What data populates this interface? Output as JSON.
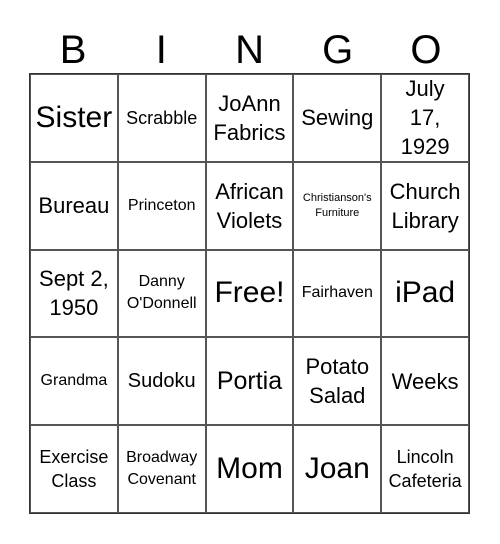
{
  "header": [
    "B",
    "I",
    "N",
    "G",
    "O"
  ],
  "cells": [
    [
      "Sister",
      "Scrabble",
      "JoAnn Fabrics",
      "Sewing",
      "July 17, 1929"
    ],
    [
      "Bureau",
      "Princeton",
      "African Violets",
      "Christianson's Furniture",
      "Church Library"
    ],
    [
      "Sept 2, 1950",
      "Danny O'Donnell",
      "Free!",
      "Fairhaven",
      "iPad"
    ],
    [
      "Grandma",
      "Sudoku",
      "Portia",
      "Potato Salad",
      "Weeks"
    ],
    [
      "Exercise Class",
      "Broadway Covenant",
      "Mom",
      "Joan",
      "Lincoln Cafeteria"
    ]
  ]
}
